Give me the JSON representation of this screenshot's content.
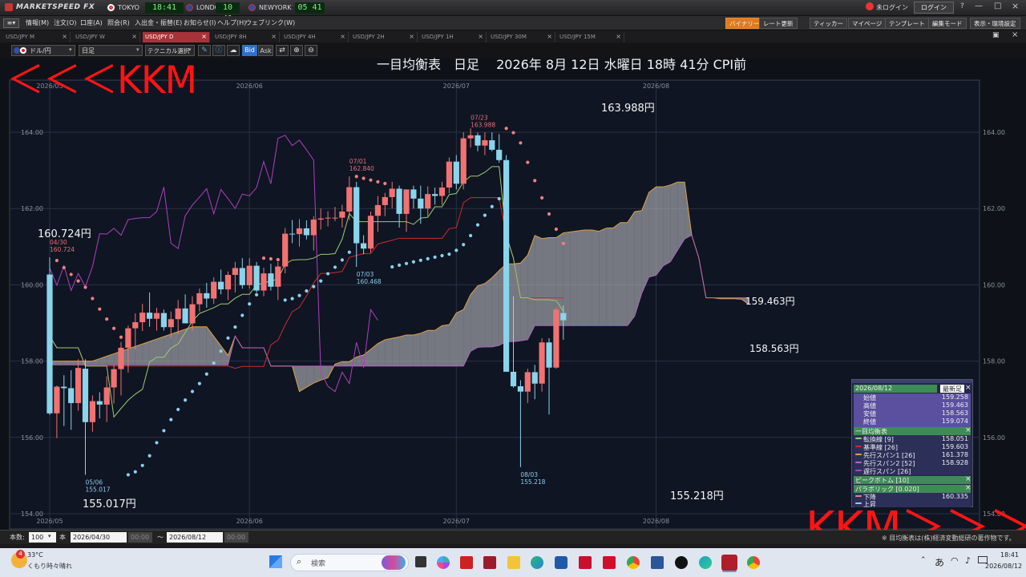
{
  "title_bar": {
    "app_name": "MARKETSPEED FX",
    "markets": [
      {
        "name": "TOKYO",
        "time": "18:41"
      },
      {
        "name": "LONDON",
        "time": "10 41"
      },
      {
        "name": "NEWYORK",
        "time": "05 41"
      }
    ],
    "login_status": "未ログイン",
    "login_button": "ログイン"
  },
  "menu": {
    "items": [
      "情報(M)",
      "注文(O)",
      "口座(A)",
      "照会(R)",
      "入出金・振替(E)",
      "お知らせ(I)",
      "ヘルプ(H)",
      "ウェブリンク(W)"
    ],
    "right_buttons": [
      "バイナリー",
      "レート更新",
      "ティッカー",
      "マイページ",
      "テンプレート",
      "編集モード",
      "表示・環境設定"
    ]
  },
  "tabs": [
    {
      "label": "USD/JPY M",
      "active": false
    },
    {
      "label": "USD/JPY W",
      "active": false
    },
    {
      "label": "USD/JPY D",
      "active": true
    },
    {
      "label": "USD/JPY 8H",
      "active": false
    },
    {
      "label": "USD/JPY 4H",
      "active": false
    },
    {
      "label": "USD/JPY 2H",
      "active": false
    },
    {
      "label": "USD/JPY 1H",
      "active": false
    },
    {
      "label": "USD/JPY 30M",
      "active": false
    },
    {
      "label": "USD/JPY 15M",
      "active": false
    }
  ],
  "toolbar": {
    "pair": "ドル/円",
    "period": "日足",
    "tech_select": "テクニカル選択",
    "bid": "Bid",
    "ask": "Ask"
  },
  "overlay": {
    "chart_title": "一目均衡表　日足　 2026年 8月 12日 水曜日 18時 41分 CPI前",
    "kkm_left": "＜＜＜KKM",
    "kkm_right": "KKM＞＞＞",
    "price_callouts": [
      "163.988円",
      "160.724円",
      "155.017円",
      "155.218円",
      "159.463円",
      "158.563円"
    ]
  },
  "footer": {
    "count_label": "本数:",
    "count_value": "100",
    "base_label": "本",
    "from_date": "2026/04/30",
    "from_time": "00:00",
    "tilde": "〜",
    "to_date": "2026/08/12",
    "to_time": "00:00",
    "note": "※ 目均衡表は(株)経済変動総研の著作物です。"
  },
  "info_box": {
    "date": "2026/08/12",
    "newest": "最新足",
    "ohlc": [
      {
        "label": "始値",
        "value": "159.258"
      },
      {
        "label": "高値",
        "value": "159.463"
      },
      {
        "label": "安値",
        "value": "158.563"
      },
      {
        "label": "終値",
        "value": "159.074"
      }
    ],
    "ichimoku_header": "一目均衡表",
    "ichimoku": [
      {
        "label": "転換線 [9]",
        "value": "158.051",
        "color": "#9acd6e"
      },
      {
        "label": "基準線 [26]",
        "value": "159.603",
        "color": "#d02a2a"
      },
      {
        "label": "先行スパン1 [26]",
        "value": "161.378",
        "color": "#e0a040"
      },
      {
        "label": "先行スパン2 [52]",
        "value": "158.928",
        "color": "#c060d0"
      },
      {
        "label": "遅行スパン [26]",
        "value": "",
        "color": "#b040c0"
      }
    ],
    "peak_header": "ピークボトム [10]",
    "sar_header": "パラボリック [0.020]",
    "sar": [
      {
        "label": "下降",
        "value": "160.335",
        "color": "#f08080"
      },
      {
        "label": "上昇",
        "value": "",
        "color": "#8ad0f0"
      }
    ]
  },
  "taskbar": {
    "weather_temp": "33°C",
    "weather_text": "くもり時々晴れ",
    "search_placeholder": "検索",
    "ime": "あ",
    "clock_time": "18:41",
    "clock_date": "2026/08/12",
    "notification_count": "4"
  },
  "chart_data": {
    "type": "candlestick",
    "instrument": "USD/JPY",
    "timeframe": "daily",
    "ylim": [
      154.0,
      165.2
    ],
    "y_ticks": [
      154.0,
      156.0,
      158.0,
      160.0,
      162.0,
      164.0
    ],
    "y_tick_labels": [
      "154.00",
      "156.00",
      "158.00",
      "160.00",
      "162.00",
      "164.00"
    ],
    "x_tick_labels": [
      "2026/05",
      "2026/06",
      "2026/07",
      "2026/08"
    ],
    "grid": true,
    "colors": {
      "up": "#f27272",
      "down": "#8ad4ec",
      "tenkan": "#9acd6e",
      "kijun": "#d02a2a",
      "span1": "#e0a040",
      "span2": "#c060d0",
      "chikou": "#b040c0",
      "cloud": "#b4b4bc",
      "sar_down": "#f08080",
      "sar_up": "#8ad0f0",
      "annotation": "#e87070",
      "annotation_low": "#8ecde8"
    },
    "candles": [
      [
        160.27,
        160.72,
        156.59,
        156.63
      ],
      [
        156.63,
        157.36,
        155.98,
        157.33
      ],
      [
        157.33,
        157.63,
        156.3,
        157.29
      ],
      [
        157.29,
        157.76,
        156.2,
        156.9
      ],
      [
        156.9,
        158.05,
        156.7,
        157.82
      ],
      [
        157.8,
        158.05,
        155.02,
        156.4
      ],
      [
        156.4,
        157.1,
        156.15,
        156.95
      ],
      [
        156.95,
        157.18,
        156.5,
        156.86
      ],
      [
        156.86,
        157.6,
        156.4,
        157.31
      ],
      [
        157.31,
        157.9,
        156.89,
        157.79
      ],
      [
        157.79,
        158.5,
        157.1,
        158.35
      ],
      [
        158.35,
        158.93,
        157.7,
        158.86
      ],
      [
        158.86,
        159.25,
        158.3,
        159.02
      ],
      [
        159.02,
        159.5,
        158.79,
        159.27
      ],
      [
        159.27,
        159.8,
        158.9,
        159.11
      ],
      [
        159.11,
        159.4,
        158.8,
        159.26
      ],
      [
        159.26,
        159.35,
        158.8,
        158.89
      ],
      [
        158.89,
        159.3,
        158.6,
        159.1
      ],
      [
        159.1,
        159.6,
        158.7,
        159.38
      ],
      [
        159.38,
        159.75,
        159.05,
        158.99
      ],
      [
        158.99,
        159.7,
        158.8,
        159.49
      ],
      [
        159.49,
        159.9,
        159.3,
        159.78
      ],
      [
        159.78,
        160.05,
        159.4,
        159.64
      ],
      [
        159.64,
        160.2,
        159.5,
        160.08
      ],
      [
        160.08,
        160.4,
        159.75,
        159.88
      ],
      [
        159.88,
        160.35,
        159.6,
        160.26
      ],
      [
        160.26,
        160.6,
        159.8,
        160.44
      ],
      [
        160.44,
        160.7,
        159.9,
        159.99
      ],
      [
        159.99,
        160.7,
        159.9,
        160.5
      ],
      [
        160.5,
        160.6,
        159.8,
        159.85
      ],
      [
        159.85,
        160.45,
        159.7,
        160.3
      ],
      [
        160.3,
        160.55,
        159.85,
        159.95
      ],
      [
        159.95,
        160.6,
        159.6,
        160.48
      ],
      [
        160.48,
        161.49,
        160.3,
        161.34
      ],
      [
        161.34,
        161.7,
        161.09,
        161.33
      ],
      [
        161.33,
        161.72,
        161.0,
        161.48
      ],
      [
        161.48,
        161.69,
        161.19,
        161.3
      ],
      [
        161.3,
        161.8,
        160.9,
        161.71
      ],
      [
        161.71,
        162.0,
        161.45,
        161.74
      ],
      [
        161.74,
        161.93,
        161.53,
        161.76
      ],
      [
        161.76,
        162.04,
        161.67,
        161.76
      ],
      [
        161.76,
        162.1,
        161.5,
        161.92
      ],
      [
        161.92,
        162.84,
        161.7,
        162.56
      ],
      [
        162.56,
        162.7,
        160.47,
        161.09
      ],
      [
        161.09,
        161.3,
        160.8,
        160.95
      ],
      [
        160.95,
        161.92,
        160.84,
        161.81
      ],
      [
        161.81,
        162.33,
        161.39,
        162.09
      ],
      [
        162.09,
        162.41,
        161.8,
        162.3
      ],
      [
        162.3,
        162.7,
        162.0,
        162.52
      ],
      [
        162.52,
        162.6,
        161.5,
        161.86
      ],
      [
        161.86,
        162.5,
        161.39,
        162.5
      ],
      [
        162.5,
        162.6,
        162.0,
        162.26
      ],
      [
        162.26,
        162.6,
        161.6,
        162.0
      ],
      [
        162.0,
        162.58,
        161.8,
        162.38
      ],
      [
        162.38,
        162.55,
        162.1,
        162.33
      ],
      [
        162.33,
        162.7,
        162.1,
        162.55
      ],
      [
        162.55,
        163.34,
        162.4,
        163.23
      ],
      [
        163.23,
        163.4,
        162.5,
        162.65
      ],
      [
        162.65,
        164.0,
        162.5,
        163.84
      ],
      [
        163.84,
        164.1,
        163.6,
        163.92
      ],
      [
        163.92,
        163.99,
        163.5,
        163.65
      ],
      [
        163.65,
        164.0,
        163.4,
        163.79
      ],
      [
        163.79,
        164.0,
        163.5,
        163.54
      ],
      [
        163.54,
        163.95,
        163.2,
        163.27
      ],
      [
        163.27,
        163.4,
        158.5,
        157.72
      ],
      [
        157.72,
        159.7,
        157.3,
        157.34
      ],
      [
        157.34,
        157.5,
        155.22,
        157.2
      ],
      [
        157.2,
        157.8,
        156.9,
        157.71
      ],
      [
        157.71,
        157.9,
        157.0,
        157.41
      ],
      [
        157.41,
        158.6,
        157.2,
        158.49
      ],
      [
        158.49,
        158.6,
        156.6,
        157.83
      ],
      [
        157.83,
        159.4,
        157.8,
        159.35
      ],
      [
        159.26,
        159.46,
        158.56,
        159.07
      ]
    ],
    "annotations": [
      {
        "date": "04/30",
        "value": 160.724,
        "type": "peak"
      },
      {
        "date": "05/06",
        "value": 155.017,
        "type": "bottom"
      },
      {
        "date": "07/01",
        "value": 162.84,
        "type": "peak"
      },
      {
        "date": "07/03",
        "value": 160.468,
        "type": "bottom"
      },
      {
        "date": "07/23",
        "value": 163.988,
        "type": "peak"
      },
      {
        "date": "08/03",
        "value": 155.218,
        "type": "bottom"
      }
    ]
  }
}
